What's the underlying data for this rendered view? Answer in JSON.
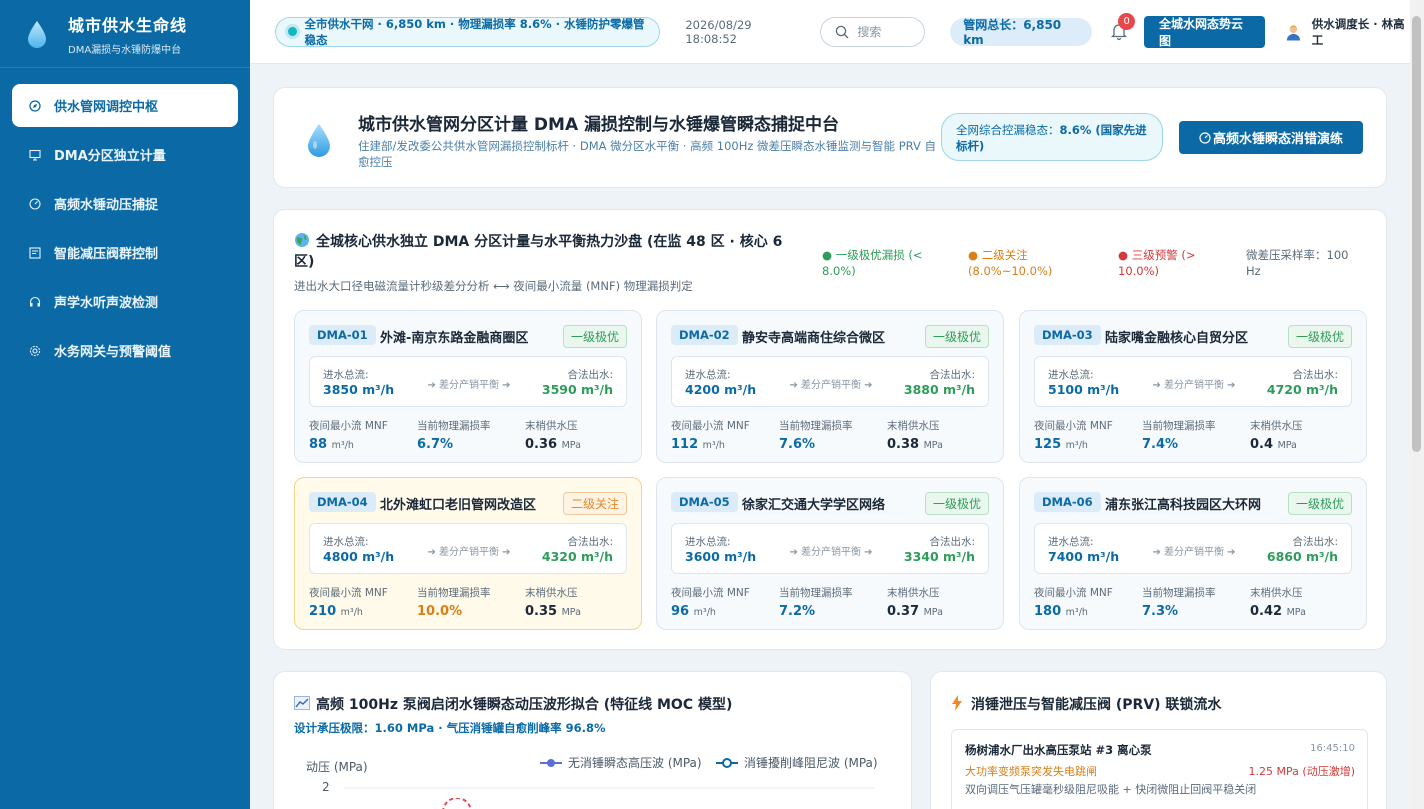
{
  "app": {
    "title": "城市供水生命线",
    "subtitle": "DMA漏损与水锤防爆中台"
  },
  "sidebar": {
    "items": [
      {
        "label": "供水管网调控中枢",
        "icon": "compass-icon",
        "active": true
      },
      {
        "label": "DMA分区独立计量",
        "icon": "monitor-icon",
        "active": false
      },
      {
        "label": "高频水锤动压捕捉",
        "icon": "gauge-icon",
        "active": false
      },
      {
        "label": "智能减压阀群控制",
        "icon": "panel-icon",
        "active": false
      },
      {
        "label": "声学水听声波检测",
        "icon": "headphones-icon",
        "active": false
      },
      {
        "label": "水务网关与预警阈值",
        "icon": "gear-icon",
        "active": false
      }
    ]
  },
  "topbar": {
    "ticker": "全市供水干网 · 6,850 km · 物理漏损率 8.6% · 水锤防护零爆管稳态",
    "datetime": "2026/08/29 18:08:52",
    "search_placeholder": "搜索",
    "pipe_total": "管网总长：6,850 km",
    "notification_count": "0",
    "global_button": "全城水网态势云图",
    "user": "供水调度长 · 林高工"
  },
  "hero": {
    "title": "城市供水管网分区计量 DMA 漏损控制与水锤爆管瞬态捕捉中台",
    "subtitle": "住建部/发改委公共供水管网漏损控制标杆 · DMA 微分区水平衡 · 高频 100Hz 微差压瞬态水锤监测与智能 PRV 自愈控压",
    "badge_prefix": "全网综合控漏稳态：",
    "badge_value": "8.6% (国家先进标杆)",
    "drill_button": "高频水锤瞬态消错演练"
  },
  "dma_panel": {
    "title": "全城核心供水独立 DMA 分区计量与水平衡热力沙盘 (在监 48 区 · 核心 6 区)",
    "subtitle": "进出水大口径电磁流量计秒级差分分析 ⟷ 夜间最小流量 (MNF) 物理漏损判定",
    "legend": {
      "green": "● 一级极优漏损 (< 8.0%)",
      "orange": "● 二级关注 (8.0%~10.0%)",
      "red": "● 三级预警 (> 10.0%)",
      "rate": "微差压采样率：100 Hz"
    },
    "labels": {
      "inflow": "进水总流:",
      "outflow": "合法出水:",
      "balance": "➔ 差分产销平衡 ➔",
      "mnf": "夜间最小流 MNF",
      "loss": "当前物理漏损率",
      "pressure": "末梢供水压"
    },
    "zones": [
      {
        "id": "DMA-01",
        "name": "外滩-南京东路金融商圈区",
        "level": "一级极优",
        "status": "good",
        "inflow": "3850 m³/h",
        "outflow": "3590 m³/h",
        "mnf": "88",
        "mnf_unit": "m³/h",
        "loss": "6.7%",
        "pressure": "0.36",
        "pressure_unit": "MPa"
      },
      {
        "id": "DMA-02",
        "name": "静安寺高端商住综合微区",
        "level": "一级极优",
        "status": "good",
        "inflow": "4200 m³/h",
        "outflow": "3880 m³/h",
        "mnf": "112",
        "mnf_unit": "m³/h",
        "loss": "7.6%",
        "pressure": "0.38",
        "pressure_unit": "MPa"
      },
      {
        "id": "DMA-03",
        "name": "陆家嘴金融核心自贸分区",
        "level": "一级极优",
        "status": "good",
        "inflow": "5100 m³/h",
        "outflow": "4720 m³/h",
        "mnf": "125",
        "mnf_unit": "m³/h",
        "loss": "7.4%",
        "pressure": "0.4",
        "pressure_unit": "MPa"
      },
      {
        "id": "DMA-04",
        "name": "北外滩虹口老旧管网改造区",
        "level": "二级关注",
        "status": "attn",
        "inflow": "4800 m³/h",
        "outflow": "4320 m³/h",
        "mnf": "210",
        "mnf_unit": "m³/h",
        "loss": "10.0%",
        "pressure": "0.35",
        "pressure_unit": "MPa"
      },
      {
        "id": "DMA-05",
        "name": "徐家汇交通大学学区网络",
        "level": "一级极优",
        "status": "good",
        "inflow": "3600 m³/h",
        "outflow": "3340 m³/h",
        "mnf": "96",
        "mnf_unit": "m³/h",
        "loss": "7.2%",
        "pressure": "0.37",
        "pressure_unit": "MPa"
      },
      {
        "id": "DMA-06",
        "name": "浦东张江高科技园区大环网",
        "level": "一级极优",
        "status": "good",
        "inflow": "7400 m³/h",
        "outflow": "6860 m³/h",
        "mnf": "180",
        "mnf_unit": "m³/h",
        "loss": "7.3%",
        "pressure": "0.42",
        "pressure_unit": "MPa"
      }
    ]
  },
  "wave_panel": {
    "title": "高频 100Hz 泵阀启闭水锤瞬态动压波形拟合 (特征线 MOC 模型)",
    "subtitle": "设计承压极限：1.60 MPa · 气压消锤罐自愈削峰率 96.8%",
    "ylabel": "动压 (MPa)",
    "ytick": "2",
    "legend": [
      {
        "label": "无消锤瞬态高压波 (MPa)",
        "color": "#5b6fd6"
      },
      {
        "label": "消锤擾削峰阻尼波 (MPa)",
        "color": "#0b6aa6"
      }
    ]
  },
  "prv_panel": {
    "title": "消锤泄压与智能减压阀 (PRV) 联锁流水",
    "item": {
      "name": "杨树浦水厂出水高压泵站 #3 离心泵",
      "time": "16:45:10",
      "event": "大功率变频泵突发失电跳闸",
      "pressure": "1.25 MPa (动压激增)",
      "action": "双向调压气压罐毫秒级阻尼吸能 + 快闭微阻止回阀平稳关闭"
    }
  }
}
